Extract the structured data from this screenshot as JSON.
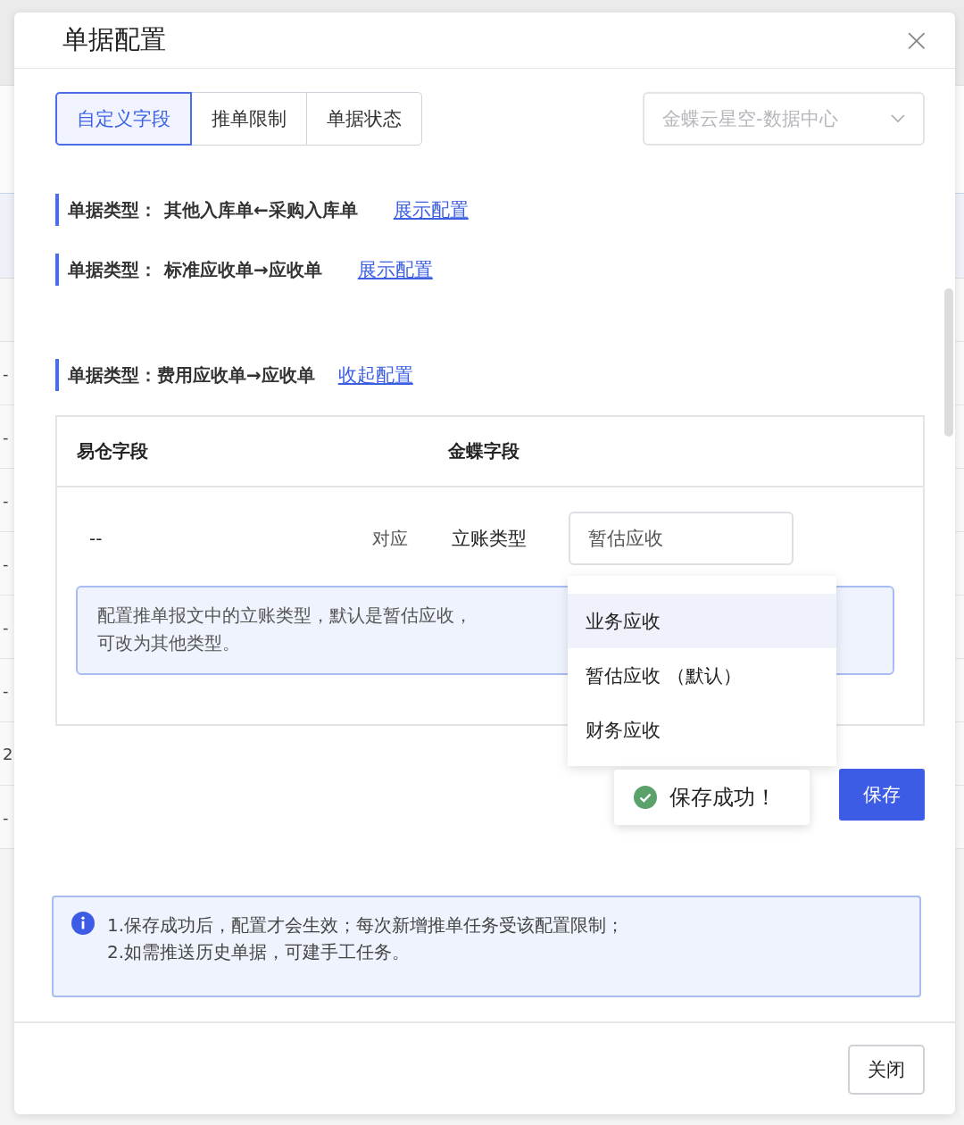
{
  "background_table": {
    "column_1": [
      "-",
      "-",
      "-",
      "-",
      "-",
      "-",
      "2",
      "-"
    ]
  },
  "dialog": {
    "title": "单据配置",
    "close": "×",
    "tabs": [
      {
        "label": "自定义字段",
        "selected": true
      },
      {
        "label": "推单限制",
        "selected": false
      },
      {
        "label": "单据状态",
        "selected": false
      }
    ],
    "source_select": {
      "value": "金蝶云星空-数据中心",
      "disabled": true
    },
    "doc_types": [
      {
        "label": "单据类型：",
        "name": "其他入库单←采购入库单",
        "link": "展示配置",
        "expanded": false
      },
      {
        "label": "单据类型：",
        "name": "标准应收单→应收单",
        "link": "展示配置",
        "expanded": false
      },
      {
        "label": "单据类型：",
        "name": "费用应收单→应收单",
        "link": "收起配置",
        "expanded": true
      }
    ],
    "mapping_table": {
      "columns": [
        "易仓字段",
        "金蝶字段"
      ],
      "rows": [
        {
          "source": "--",
          "relation": "对应",
          "target": "立账类型",
          "value": "暂估应收",
          "hint": [
            "配置推单报文中的立账类型，默认是暂估应收，",
            "可改为其他类型。"
          ]
        }
      ]
    },
    "dropdown": [
      {
        "label": "业务应收",
        "highlighted": true
      },
      {
        "label": "暂估应收 （默认）",
        "highlighted": false
      },
      {
        "label": "财务应收",
        "highlighted": false
      }
    ],
    "toast": {
      "kind": "success",
      "text": "保存成功！"
    },
    "save_button": "保存",
    "notice": {
      "lines": [
        "1.保存成功后，配置才会生效；每次新增推单任务受该配置限制；",
        "2.如需推送历史单据，可建手工任务。"
      ]
    },
    "close_button": "关闭"
  }
}
